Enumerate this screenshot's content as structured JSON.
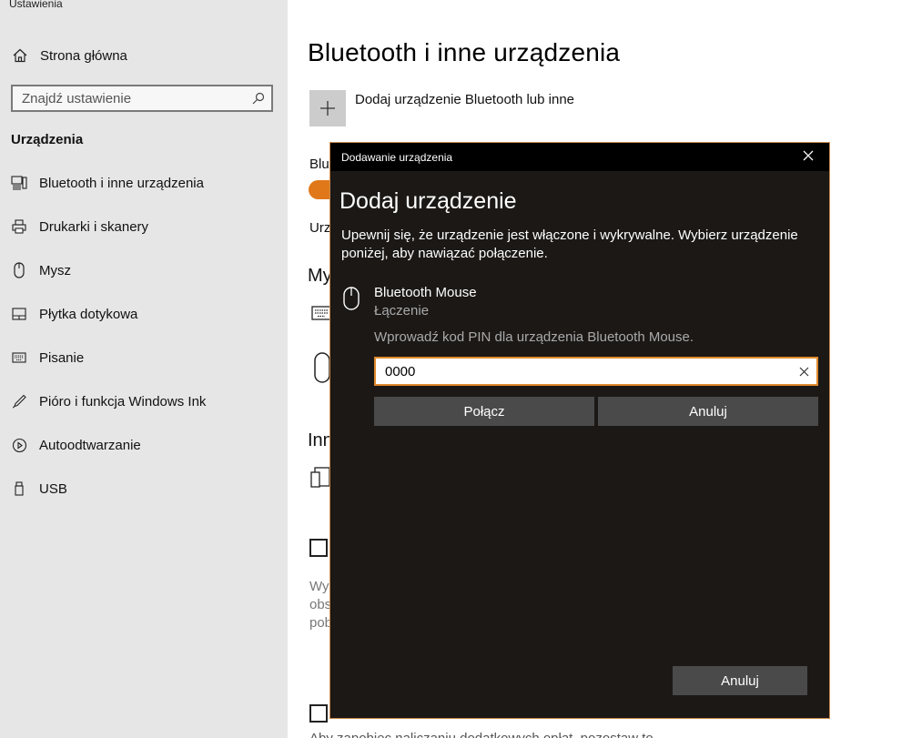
{
  "app": {
    "title": "Ustawienia"
  },
  "sidebar": {
    "home": "Strona główna",
    "search_placeholder": "Znajdź ustawienie",
    "section": "Urządzenia",
    "items": [
      {
        "label": "Bluetooth i inne urządzenia",
        "icon": "bluetooth-devices-icon"
      },
      {
        "label": "Drukarki i skanery",
        "icon": "printer-icon"
      },
      {
        "label": "Mysz",
        "icon": "mouse-icon"
      },
      {
        "label": "Płytka dotykowa",
        "icon": "touchpad-icon"
      },
      {
        "label": "Pisanie",
        "icon": "keyboard-icon"
      },
      {
        "label": "Pióro i funkcja Windows Ink",
        "icon": "pen-icon"
      },
      {
        "label": "Autoodtwarzanie",
        "icon": "autoplay-icon"
      },
      {
        "label": "USB",
        "icon": "usb-icon"
      }
    ]
  },
  "main": {
    "title": "Bluetooth i inne urządzenia",
    "add_device": "Dodaj urządzenie Bluetooth lub inne",
    "bluetooth_label_partial": "Bluc",
    "status_partial": "Urz",
    "section_mouse_partial": "My",
    "section_other_partial": "Inn",
    "desc_partial": [
      "Wy",
      "obs",
      "pob"
    ],
    "footer_partial": "Aby zapobiec naliczaniu dodatkowych opłat, pozostaw to"
  },
  "dialog": {
    "title": "Dodawanie urządzenia",
    "heading": "Dodaj urządzenie",
    "description": "Upewnij się, że urządzenie jest włączone i wykrywalne. Wybierz urządzenie poniżej, aby nawiązać połączenie.",
    "device": {
      "name": "Bluetooth Mouse",
      "status": "Łączenie"
    },
    "pin_prompt": "Wprowadź kod PIN dla urządzenia Bluetooth Mouse.",
    "pin_value": "0000",
    "connect_button": "Połącz",
    "cancel_button": "Anuluj",
    "cancel_bottom_button": "Anuluj"
  },
  "colors": {
    "accent": "#e0781a",
    "dialog_bg": "#1b1816",
    "sidebar_bg": "#e6e6e6"
  }
}
